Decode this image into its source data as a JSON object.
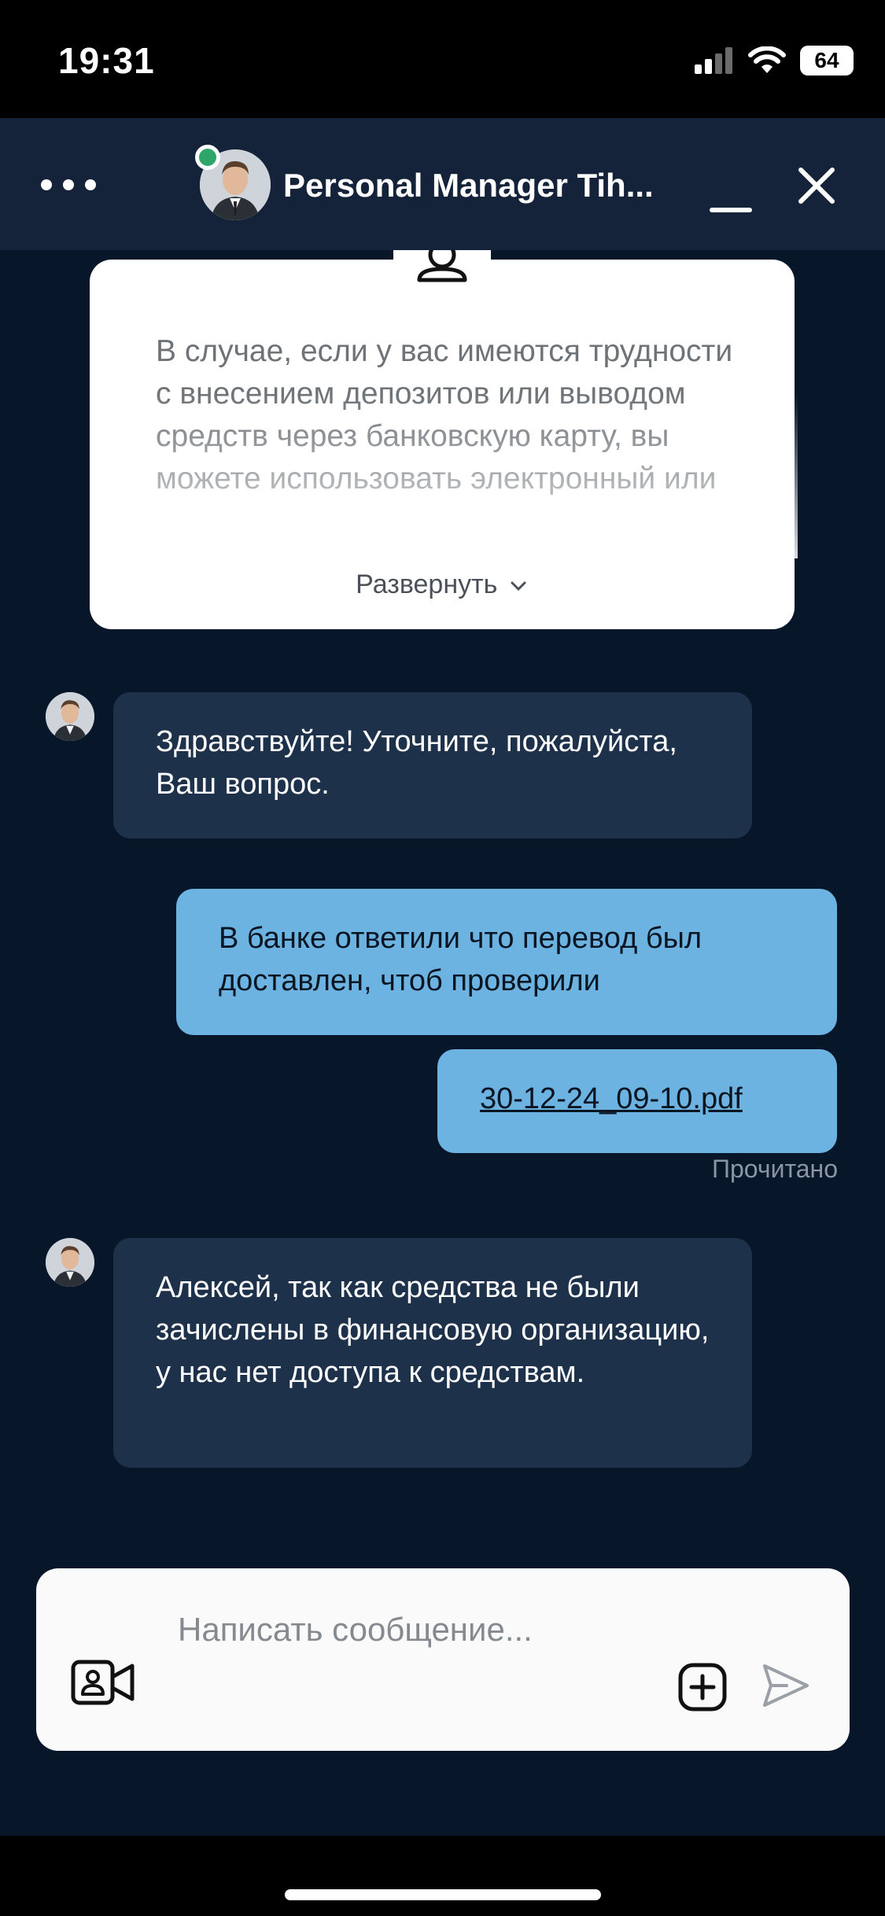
{
  "status_bar": {
    "time": "19:31",
    "battery": "64",
    "icons": [
      "cellular-signal-icon",
      "wifi-icon",
      "battery-icon"
    ]
  },
  "header": {
    "title": "Personal Manager Tih...",
    "menu_icon": "more-dots-icon",
    "minimize_icon": "minimize-icon",
    "close_icon": "close-icon",
    "online": true
  },
  "info_card": {
    "icon": "user-icon",
    "text": "В случае, если у вас имеются трудности с внесением депозитов или выводом средств через банковскую карту, вы можете использовать электронный или",
    "expand_label": "Развернуть"
  },
  "messages": [
    {
      "from": "manager",
      "text": "Здравствуйте! Уточните, пожалуйста, Ваш вопрос."
    },
    {
      "from": "user",
      "text": "В банке ответили что перевод был доставлен, чтоб проверили"
    },
    {
      "from": "user",
      "file": "30-12-24_09-10.pdf"
    },
    {
      "from": "manager",
      "text": "Алексей, так как средства не были зачислены в финансовую организацию, у нас нет доступа к средствам."
    }
  ],
  "read_status": "Прочитано",
  "composer": {
    "placeholder": "Написать сообщение...",
    "video_icon": "video-call-icon",
    "attach_icon": "add-attachment-icon",
    "send_icon": "send-icon"
  },
  "colors": {
    "header_bg": "#15233a",
    "chat_bg": "#08162a",
    "incoming_bubble": "#1e314b",
    "outgoing_bubble": "#6cb3e2",
    "online": "#2ea66a"
  }
}
